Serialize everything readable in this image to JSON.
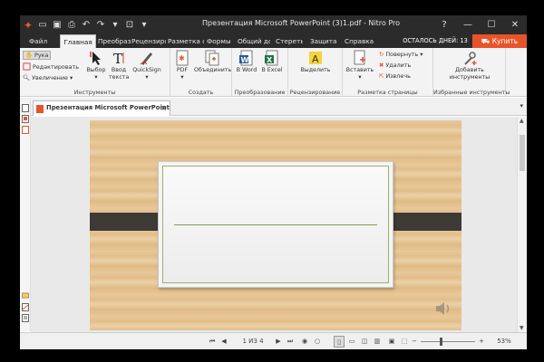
{
  "titlebar": {
    "title": "Презентация Microsoft PowerPoint (3)1.pdf - Nitro Pro",
    "minimize": "—",
    "restore": "☐",
    "close": "✕"
  },
  "tabs": {
    "file": "Файл",
    "home": "Главная",
    "convert": "Преобраз",
    "review": "Рецензирс",
    "layout": "Разметка с",
    "forms": "Формы",
    "share": "Общий до",
    "erase": "Стереть",
    "protect": "Защита",
    "help": "Справка"
  },
  "trial_text": "ОСТАЛОСЬ ДНЕЙ: 13",
  "buy_label": "Купить",
  "ribbon": {
    "hand": "Рука",
    "edit": "Редактировать",
    "zoom": "Увеличение",
    "select": "Выбор",
    "type_text": "Ввод текста",
    "quicksign": "QuickSign",
    "group_tools": "Инструменты",
    "pdf": "PDF",
    "combine": "Объединить",
    "group_create": "Создать",
    "to_word": "В Word",
    "to_excel": "В Excel",
    "group_convert": "Преобразование",
    "highlight": "Выделить",
    "group_review": "Рецензирование",
    "insert": "Вставить",
    "rotate": "Повернуть",
    "delete": "Удалить",
    "extract": "Извлечь",
    "group_page": "Разметка страницы",
    "add_tools": "Добавить инструменты",
    "group_fav": "Избранные инструменты"
  },
  "doc_tab": {
    "label": "Презентация Microsoft PowerPoint ...",
    "close": "×"
  },
  "status": {
    "page": "1 ИЗ 4",
    "zoom": "53%"
  },
  "colors": {
    "accent": "#e8542a",
    "titlebar": "#2b2b2b",
    "band": "#3e3a35",
    "card_border": "#9cb069"
  }
}
